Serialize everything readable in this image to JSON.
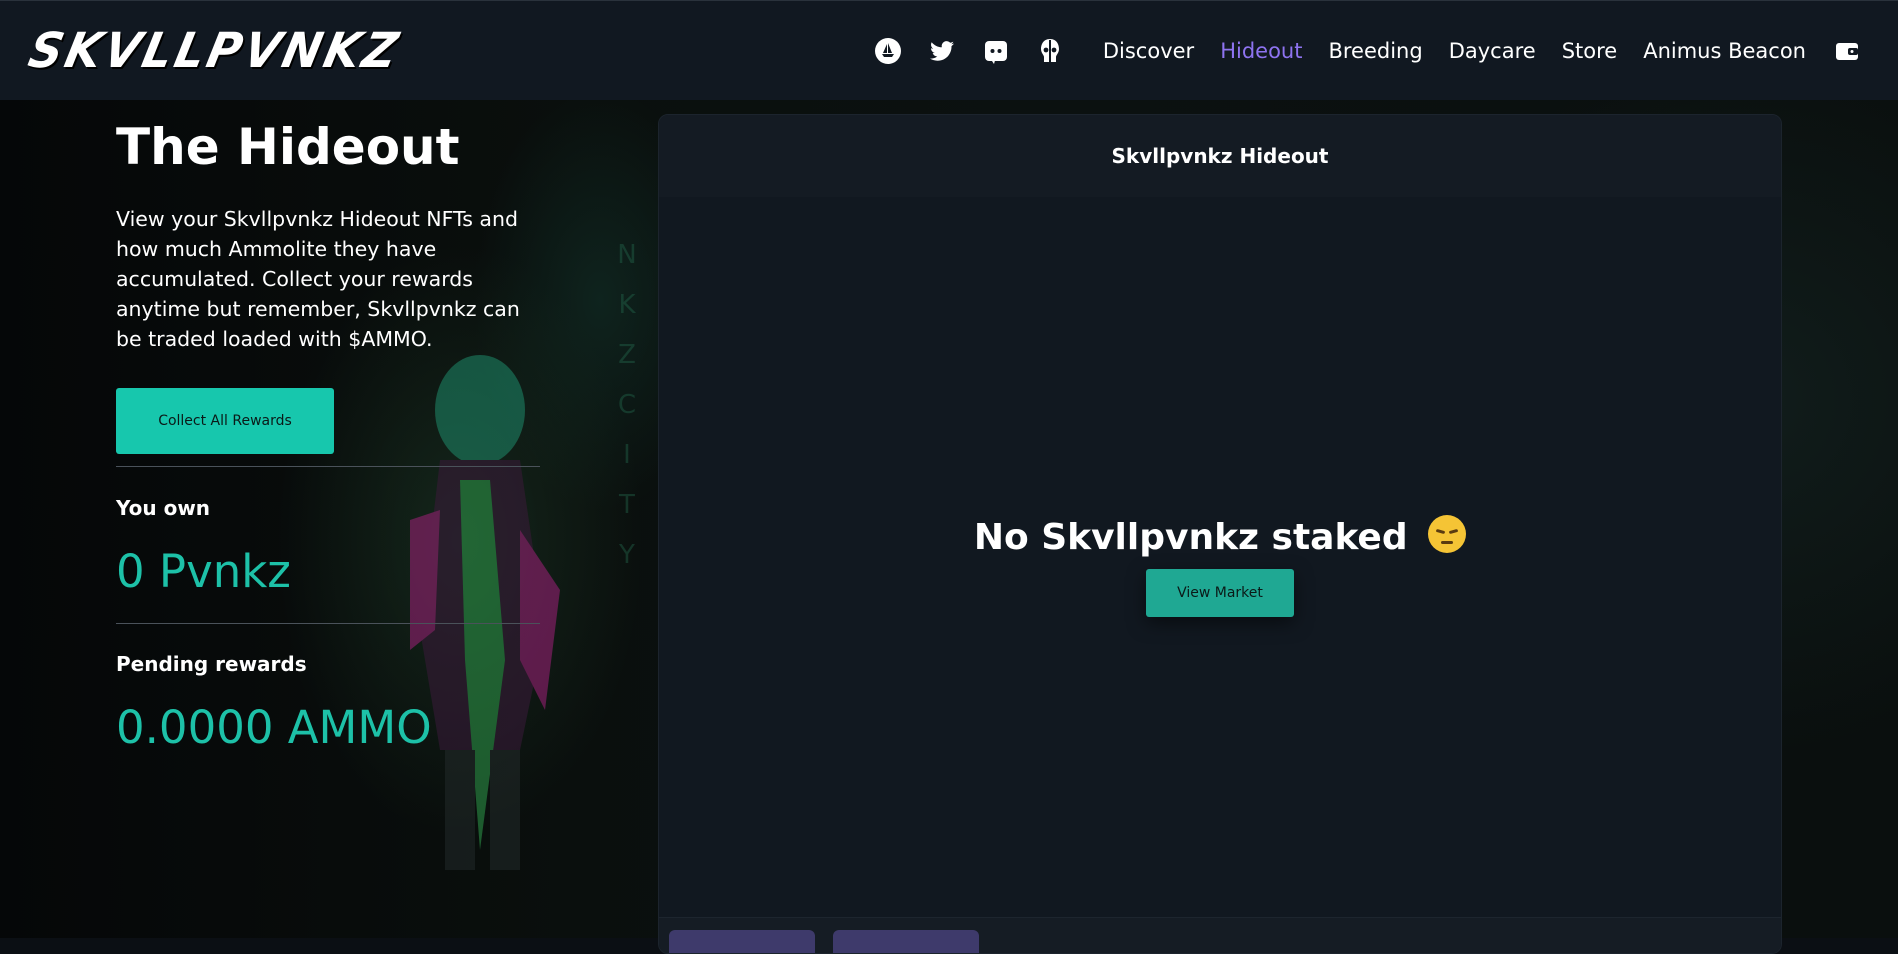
{
  "nav": {
    "logo_text": "SKVLLPVNKZ",
    "icons": [
      "opensea-icon",
      "twitter-icon",
      "discord-icon",
      "skull-icon",
      "wallet-icon"
    ],
    "links": [
      {
        "label": "Discover",
        "active": false
      },
      {
        "label": "Hideout",
        "active": true
      },
      {
        "label": "Breeding",
        "active": false
      },
      {
        "label": "Daycare",
        "active": false
      },
      {
        "label": "Store",
        "active": false
      },
      {
        "label": "Animus Beacon",
        "active": false
      }
    ],
    "active_color": "#8e73f0"
  },
  "hero": {
    "title": "The Hideout",
    "description": "View your Skvllpvnkz Hideout NFTs and how much Ammolite they have accumulated. Collect your rewards anytime but remember, Skvllpvnkz can be traded loaded with $AMMO.",
    "collect_button": "Collect All Rewards"
  },
  "stats": {
    "own_label": "You own",
    "own_value": "0 Pvnkz",
    "pending_label": "Pending rewards",
    "pending_value": "0.0000 AMMO"
  },
  "panel": {
    "title": "Skvllpvnkz Hideout",
    "empty_message": "No Skvllpvnkz staked",
    "empty_emoji": "pensive-face-icon",
    "market_button": "View Market"
  },
  "colors": {
    "accent": "#17c7ad",
    "background": "#0b0f14",
    "panel": "#111820"
  }
}
